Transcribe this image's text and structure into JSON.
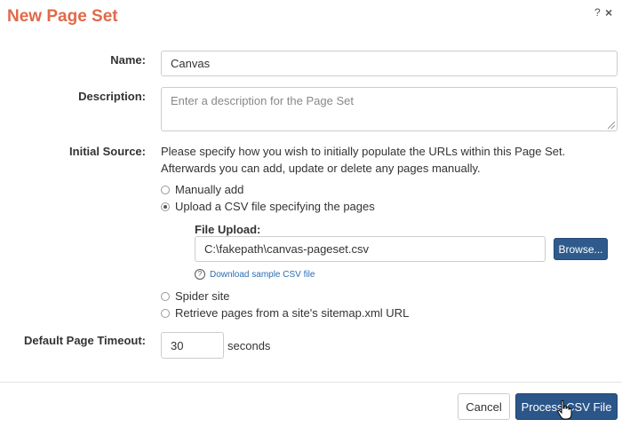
{
  "dialog": {
    "title": "New Page Set",
    "help_glyph": "?",
    "close_glyph": "×"
  },
  "form": {
    "name_label": "Name:",
    "name_value": "Canvas",
    "description_label": "Description:",
    "description_placeholder": "Enter a description for the Page Set",
    "initial_source_label": "Initial Source:",
    "initial_source_help_line1": "Please specify how you wish to initially populate the URLs within this Page Set.",
    "initial_source_help_line2": "Afterwards you can add, update or delete any pages manually.",
    "options": [
      {
        "label": "Manually add",
        "checked": false
      },
      {
        "label": "Upload a CSV file specifying the pages",
        "checked": true
      },
      {
        "label": "Spider site",
        "checked": false
      },
      {
        "label": "Retrieve pages from a site's sitemap.xml URL",
        "checked": false
      }
    ],
    "file_upload_label": "File Upload:",
    "file_upload_value": "C:\\fakepath\\canvas-pageset.csv",
    "browse_label": "Browse...",
    "sample_link_label": "Download sample CSV file",
    "timeout_label": "Default Page Timeout:",
    "timeout_value": "30",
    "timeout_unit": "seconds"
  },
  "footer": {
    "cancel_label": "Cancel",
    "primary_label": "Process CSV File"
  },
  "colors": {
    "title": "#e06a4a",
    "primary_button": "#2b5689",
    "link": "#2a6db5"
  }
}
